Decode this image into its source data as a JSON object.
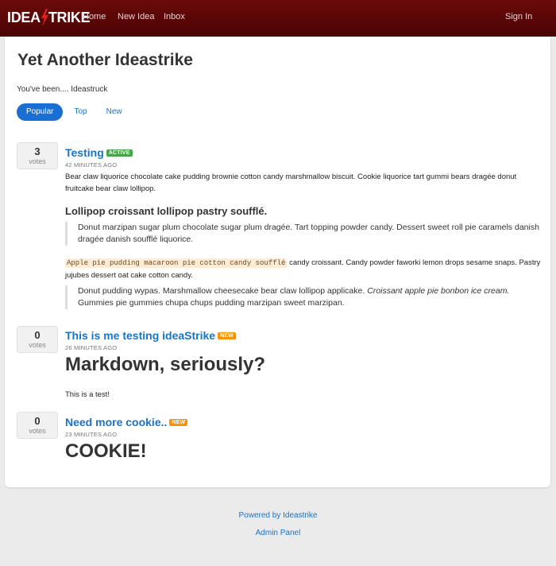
{
  "navbar": {
    "brand_left": "IDEA",
    "brand_right": "TRIKE",
    "links": [
      "Home",
      "New Idea",
      "Inbox"
    ],
    "signin": "Sign In",
    "colors": {
      "bar": "#5a0505",
      "bolt": "#e02020"
    }
  },
  "header": {
    "title": "Yet Another Ideastrike",
    "tagline": "You've been.... Ideastruck"
  },
  "tabs": [
    {
      "label": "Popular",
      "active": true
    },
    {
      "label": "Top",
      "active": false
    },
    {
      "label": "New",
      "active": false
    }
  ],
  "ideas": [
    {
      "votes": "3",
      "votes_label": "votes",
      "title": "Testing",
      "badge": "ACTIVE",
      "time": "42 MINUTES AGO",
      "p1": "Bear claw liquorice chocolate cake pudding brownie cotton candy marshmallow biscuit. Cookie liquorice tart gummi bears dragée donut fruitcake bear claw lollipop.",
      "h3": "Lollipop croissant lollipop pastry soufflé.",
      "quote1": "Donut marzipan sugar plum chocolate sugar plum dragée. Tart topping powder candy. Dessert sweet roll pie caramels danish dragée danish soufflé liquorice.",
      "code": "Apple pie pudding macaroon pie cotton candy soufflé",
      "p2_rest": " candy croissant. Candy powder faworki lemon drops sesame snaps. Pastry jujubes dessert oat cake cotton candy.",
      "quote2_a": "Donut pudding wypas. Marshmallow cheesecake bear claw lollipop applicake. ",
      "quote2_em": "Croissant apple pie bonbon ice cream.",
      "quote2_b": " Gummies pie gummies chupa chups pudding marzipan sweet marzipan."
    },
    {
      "votes": "0",
      "votes_label": "votes",
      "title": "This is me testing ideaStrike",
      "badge": "NEW",
      "time": "26 MINUTES AGO",
      "h1": "Markdown, seriously?",
      "p": "This is a test!"
    },
    {
      "votes": "0",
      "votes_label": "votes",
      "title": "Need more cookie..",
      "badge": "NEW",
      "time": "23 MINUTES AGO",
      "h1": "COOKIE!"
    }
  ],
  "footer": {
    "powered": "Powered by Ideastrike",
    "admin": "Admin Panel"
  }
}
